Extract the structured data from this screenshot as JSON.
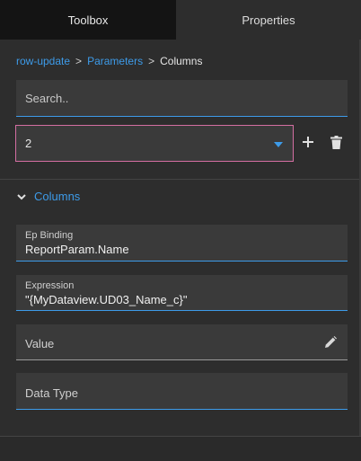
{
  "tabs": [
    {
      "label": "Toolbox",
      "active": true
    },
    {
      "label": "Properties",
      "active": false
    }
  ],
  "breadcrumb": {
    "items": [
      "row-update",
      "Parameters"
    ],
    "separator": ">",
    "current": "Columns"
  },
  "search": {
    "placeholder": "Search..",
    "value": ""
  },
  "selector": {
    "value": "2"
  },
  "section": {
    "title": "Columns",
    "expanded": true
  },
  "fields": {
    "ep_binding": {
      "label": "Ep Binding",
      "value": "ReportParam.Name"
    },
    "expression": {
      "label": "Expression",
      "value": "\"{MyDataview.UD03_Name_c}\""
    },
    "value": {
      "placeholder": "Value"
    },
    "data_type": {
      "placeholder": "Data Type"
    }
  },
  "icons": {
    "add": "plus-icon",
    "delete": "trash-icon",
    "collapse": "chevron-down-icon",
    "dropdown": "caret-down-icon",
    "edit": "pencil-icon"
  },
  "colors": {
    "accent": "#3d9be9",
    "focus_border": "#d46ea2",
    "background": "#2d2d2d",
    "field_bg": "#3a3a3a",
    "active_tab_bg": "#141414"
  }
}
